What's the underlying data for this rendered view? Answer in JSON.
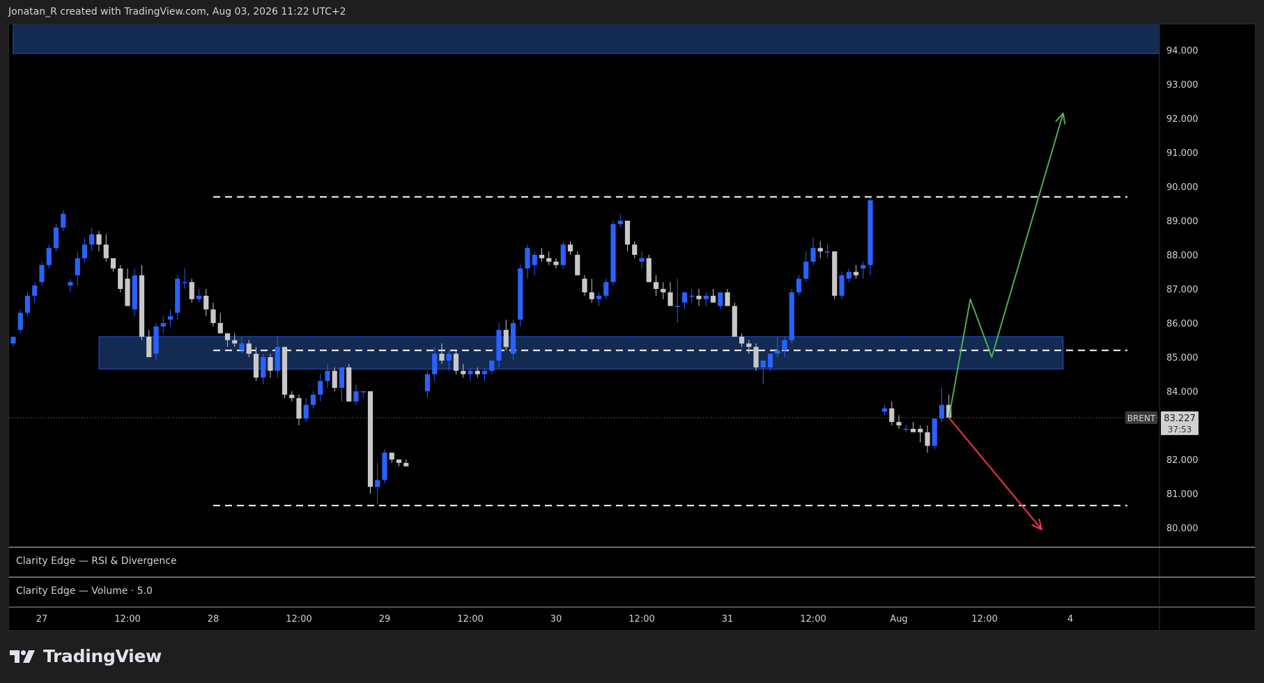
{
  "header": {
    "text": "Jonatan_R created with TradingView.com, Aug 03, 2026 11:22 UTC+2"
  },
  "panes": {
    "rsi_label": "Clarity Edge — RSI & Divergence",
    "volume_label": "Clarity Edge — Volume · 5.0"
  },
  "footer": {
    "brand": "TradingView",
    "icon": "tradingview-logo-icon"
  },
  "colors": {
    "background": "#000000",
    "bull": "#2962ff",
    "bear": "#c8c8c8",
    "zone_fill": "#132a52",
    "zone_border": "#2962ff",
    "up_arrow": "#4caf50",
    "down_arrow": "#f23645",
    "grid_text": "#d1d4dc"
  },
  "chart_data": {
    "type": "candlestick",
    "symbol": "BRENT",
    "price_label": "83.227",
    "countdown": "37:53",
    "last_price": 83.227,
    "ylim": [
      79.5,
      94.8
    ],
    "y_ticks": [
      "80.000",
      "81.000",
      "82.000",
      "83.000",
      "84.000",
      "85.000",
      "86.000",
      "87.000",
      "88.000",
      "89.000",
      "90.000",
      "91.000",
      "92.000",
      "93.000",
      "94.000"
    ],
    "x_ticks": [
      {
        "label": "27",
        "i": 0
      },
      {
        "label": "12:00",
        "i": 12
      },
      {
        "label": "28",
        "i": 24
      },
      {
        "label": "12:00",
        "i": 36
      },
      {
        "label": "29",
        "i": 48
      },
      {
        "label": "12:00",
        "i": 60
      },
      {
        "label": "30",
        "i": 72
      },
      {
        "label": "12:00",
        "i": 84
      },
      {
        "label": "31",
        "i": 96
      },
      {
        "label": "12:00",
        "i": 108
      },
      {
        "label": "Aug",
        "i": 120
      },
      {
        "label": "12:00",
        "i": 132
      },
      {
        "label": "4",
        "i": 144
      },
      {
        "label": "12:00",
        "i": 156
      }
    ],
    "candles": [
      [
        -4,
        85.4,
        85.6,
        85.3,
        85.6
      ],
      [
        -3,
        85.8,
        86.4,
        85.7,
        86.3
      ],
      [
        -2,
        86.3,
        86.9,
        86.2,
        86.8
      ],
      [
        -1,
        86.8,
        87.2,
        86.6,
        87.1
      ],
      [
        0,
        87.2,
        87.8,
        87.1,
        87.7
      ],
      [
        1,
        87.7,
        88.3,
        87.6,
        88.2
      ],
      [
        2,
        88.2,
        88.9,
        88.1,
        88.8
      ],
      [
        3,
        88.8,
        89.3,
        88.7,
        89.2
      ],
      [
        4,
        87.1,
        87.3,
        86.9,
        87.2
      ],
      [
        5,
        87.4,
        88.1,
        87.1,
        87.9
      ],
      [
        6,
        87.9,
        88.5,
        87.8,
        88.3
      ],
      [
        7,
        88.3,
        88.8,
        88.1,
        88.6
      ],
      [
        8,
        88.6,
        88.7,
        88.1,
        88.3
      ],
      [
        9,
        88.3,
        88.6,
        87.8,
        87.9
      ],
      [
        10,
        87.9,
        87.9,
        87.5,
        87.6
      ],
      [
        11,
        87.6,
        87.7,
        86.9,
        87.0
      ],
      [
        12,
        87.3,
        87.6,
        86.5,
        86.5
      ],
      [
        13,
        86.4,
        87.6,
        86.2,
        87.4
      ],
      [
        14,
        87.4,
        87.7,
        85.5,
        85.6
      ],
      [
        15,
        85.6,
        85.8,
        85.0,
        85.0
      ],
      [
        16,
        85.1,
        86.0,
        84.9,
        85.9
      ],
      [
        17,
        85.9,
        86.2,
        85.7,
        86.0
      ],
      [
        18,
        86.1,
        86.4,
        85.9,
        86.2
      ],
      [
        19,
        86.3,
        87.4,
        86.1,
        87.3
      ],
      [
        20,
        87.2,
        87.6,
        87.0,
        87.2
      ],
      [
        21,
        87.2,
        87.3,
        86.6,
        86.7
      ],
      [
        22,
        86.7,
        87.0,
        86.6,
        86.8
      ],
      [
        23,
        86.8,
        87.0,
        86.2,
        86.4
      ],
      [
        24,
        86.4,
        86.6,
        85.9,
        86.0
      ],
      [
        25,
        86.0,
        86.3,
        85.7,
        85.7
      ],
      [
        26,
        85.7,
        85.7,
        85.3,
        85.5
      ],
      [
        27,
        85.5,
        85.7,
        85.3,
        85.4
      ],
      [
        28,
        85.2,
        85.6,
        85.1,
        85.4
      ],
      [
        29,
        85.4,
        85.5,
        85.0,
        85.1
      ],
      [
        30,
        85.1,
        85.3,
        84.3,
        84.4
      ],
      [
        31,
        84.4,
        85.1,
        84.2,
        85.0
      ],
      [
        32,
        85.0,
        85.1,
        84.4,
        84.6
      ],
      [
        33,
        84.6,
        85.6,
        84.4,
        85.3
      ],
      [
        34,
        85.3,
        85.3,
        83.8,
        83.9
      ],
      [
        35,
        83.9,
        84.0,
        83.7,
        83.8
      ],
      [
        36,
        83.8,
        83.9,
        83.0,
        83.2
      ],
      [
        37,
        83.2,
        83.8,
        83.1,
        83.6
      ],
      [
        38,
        83.6,
        84.0,
        83.5,
        83.9
      ],
      [
        39,
        83.9,
        84.5,
        83.7,
        84.3
      ],
      [
        40,
        84.3,
        84.8,
        84.1,
        84.6
      ],
      [
        41,
        84.6,
        84.7,
        84.0,
        84.1
      ],
      [
        42,
        84.1,
        84.7,
        83.7,
        84.7
      ],
      [
        43,
        84.7,
        84.8,
        83.7,
        83.7
      ],
      [
        44,
        83.7,
        84.2,
        83.6,
        84.0
      ],
      [
        45,
        84.0,
        84.0,
        83.8,
        84.0
      ],
      [
        46,
        84.0,
        84.0,
        81.0,
        81.2
      ],
      [
        47,
        81.2,
        81.9,
        80.7,
        81.4
      ],
      [
        48,
        81.4,
        82.3,
        81.3,
        82.2
      ],
      [
        49,
        82.2,
        82.2,
        81.9,
        82.0
      ],
      [
        50,
        82.0,
        82.0,
        81.8,
        81.9
      ],
      [
        51,
        81.9,
        82.0,
        81.8,
        81.8
      ],
      [
        54,
        84.0,
        84.6,
        83.8,
        84.5
      ],
      [
        55,
        84.5,
        85.3,
        84.3,
        85.1
      ],
      [
        56,
        85.1,
        85.4,
        84.8,
        84.9
      ],
      [
        57,
        84.9,
        85.2,
        84.6,
        85.1
      ],
      [
        58,
        85.1,
        85.2,
        84.5,
        84.6
      ],
      [
        59,
        84.6,
        84.8,
        84.4,
        84.5
      ],
      [
        60,
        84.5,
        84.7,
        84.3,
        84.6
      ],
      [
        61,
        84.6,
        84.7,
        84.4,
        84.5
      ],
      [
        62,
        84.5,
        84.7,
        84.3,
        84.6
      ],
      [
        63,
        84.6,
        84.9,
        84.5,
        84.9
      ],
      [
        64,
        84.9,
        86.0,
        84.7,
        85.8
      ],
      [
        65,
        85.8,
        86.1,
        85.2,
        85.3
      ],
      [
        66,
        85.1,
        86.1,
        84.9,
        86.0
      ],
      [
        67,
        86.1,
        87.7,
        85.9,
        87.6
      ],
      [
        68,
        87.6,
        88.3,
        87.3,
        88.2
      ],
      [
        69,
        87.7,
        88.1,
        87.4,
        88.0
      ],
      [
        70,
        88.0,
        88.2,
        87.8,
        87.9
      ],
      [
        71,
        87.9,
        88.1,
        87.7,
        87.8
      ],
      [
        72,
        87.8,
        87.9,
        87.6,
        87.7
      ],
      [
        73,
        87.7,
        88.4,
        87.6,
        88.3
      ],
      [
        74,
        88.3,
        88.4,
        88.0,
        88.1
      ],
      [
        75,
        88.0,
        88.1,
        87.4,
        87.4
      ],
      [
        76,
        87.3,
        87.4,
        86.8,
        86.9
      ],
      [
        77,
        86.9,
        87.3,
        86.6,
        86.7
      ],
      [
        78,
        86.7,
        86.9,
        86.5,
        86.8
      ],
      [
        79,
        86.8,
        87.3,
        86.7,
        87.2
      ],
      [
        80,
        87.2,
        89.0,
        87.1,
        88.9
      ],
      [
        81,
        88.9,
        89.2,
        88.8,
        89.0
      ],
      [
        82,
        89.0,
        89.0,
        88.1,
        88.3
      ],
      [
        83,
        88.3,
        88.4,
        87.9,
        88.0
      ],
      [
        84,
        87.8,
        88.1,
        87.6,
        87.9
      ],
      [
        85,
        87.9,
        88.0,
        87.2,
        87.2
      ],
      [
        86,
        87.2,
        87.4,
        86.8,
        87.0
      ],
      [
        87,
        87.0,
        87.2,
        86.7,
        86.9
      ],
      [
        88,
        86.9,
        87.2,
        86.6,
        86.5
      ],
      [
        89,
        86.5,
        87.3,
        86.0,
        86.5
      ],
      [
        90,
        86.6,
        86.9,
        86.4,
        86.9
      ],
      [
        91,
        86.8,
        87.0,
        86.6,
        86.8
      ],
      [
        92,
        86.8,
        87.0,
        86.5,
        86.7
      ],
      [
        93,
        86.7,
        86.9,
        86.5,
        86.8
      ],
      [
        94,
        86.8,
        87.0,
        86.6,
        86.6
      ],
      [
        95,
        86.5,
        86.9,
        86.4,
        86.9
      ],
      [
        96,
        86.9,
        87.0,
        86.5,
        86.5
      ],
      [
        97,
        86.5,
        86.6,
        85.6,
        85.6
      ],
      [
        98,
        85.6,
        85.7,
        85.3,
        85.4
      ],
      [
        99,
        85.4,
        85.5,
        85.1,
        85.3
      ],
      [
        100,
        85.3,
        85.4,
        84.6,
        84.7
      ],
      [
        101,
        84.7,
        84.7,
        84.2,
        84.9
      ],
      [
        102,
        84.7,
        85.1,
        84.6,
        85.1
      ],
      [
        103,
        85.1,
        85.6,
        85.0,
        85.2
      ],
      [
        104,
        85.2,
        85.6,
        85.0,
        85.5
      ],
      [
        105,
        85.5,
        87.0,
        85.4,
        86.9
      ],
      [
        106,
        86.9,
        87.4,
        86.8,
        87.3
      ],
      [
        107,
        87.3,
        88.1,
        87.2,
        87.8
      ],
      [
        108,
        87.8,
        88.5,
        87.7,
        88.2
      ],
      [
        109,
        88.2,
        88.4,
        87.9,
        88.1
      ],
      [
        110,
        88.1,
        88.3,
        87.9,
        88.1
      ],
      [
        111,
        88.1,
        88.1,
        86.7,
        86.8
      ],
      [
        112,
        86.8,
        87.5,
        86.7,
        87.4
      ],
      [
        113,
        87.3,
        87.6,
        87.2,
        87.5
      ],
      [
        114,
        87.5,
        87.7,
        87.3,
        87.4
      ],
      [
        115,
        87.6,
        87.8,
        87.3,
        87.7
      ],
      [
        116,
        87.7,
        89.7,
        87.4,
        89.6
      ],
      [
        118,
        83.4,
        83.6,
        83.3,
        83.5
      ],
      [
        119,
        83.5,
        83.7,
        83.0,
        83.1
      ],
      [
        120,
        83.1,
        83.3,
        82.9,
        83.0
      ],
      [
        121,
        82.9,
        83.0,
        82.8,
        82.9
      ],
      [
        122,
        82.9,
        83.1,
        82.8,
        82.8
      ],
      [
        123,
        82.9,
        83.0,
        82.5,
        82.8
      ],
      [
        124,
        82.8,
        83.0,
        82.2,
        82.4
      ],
      [
        125,
        82.4,
        83.2,
        82.3,
        83.2
      ],
      [
        126,
        83.2,
        84.1,
        83.1,
        83.6
      ],
      [
        127,
        83.6,
        83.9,
        83.2,
        83.227
      ]
    ],
    "zones": [
      {
        "y_from": 93.9,
        "y_to": 94.8,
        "i_from": -4,
        "i_to": 159
      },
      {
        "y_from": 84.65,
        "y_to": 85.6,
        "i_from": 8,
        "i_to": 143
      }
    ],
    "dashed_levels": [
      {
        "y": 89.7,
        "i_from": 24,
        "i_to": 152
      },
      {
        "y": 85.2,
        "i_from": 24,
        "i_to": 152
      },
      {
        "y": 80.65,
        "i_from": 24,
        "i_to": 152
      }
    ],
    "arrows": [
      {
        "name": "up-path",
        "points": [
          [
            127,
            83.227
          ],
          [
            130,
            86.7
          ],
          [
            133,
            85.0
          ],
          [
            143,
            92.15
          ]
        ],
        "head": "end"
      },
      {
        "name": "down-path",
        "points": [
          [
            127,
            83.227
          ],
          [
            140,
            79.95
          ]
        ],
        "head": "end"
      }
    ]
  }
}
